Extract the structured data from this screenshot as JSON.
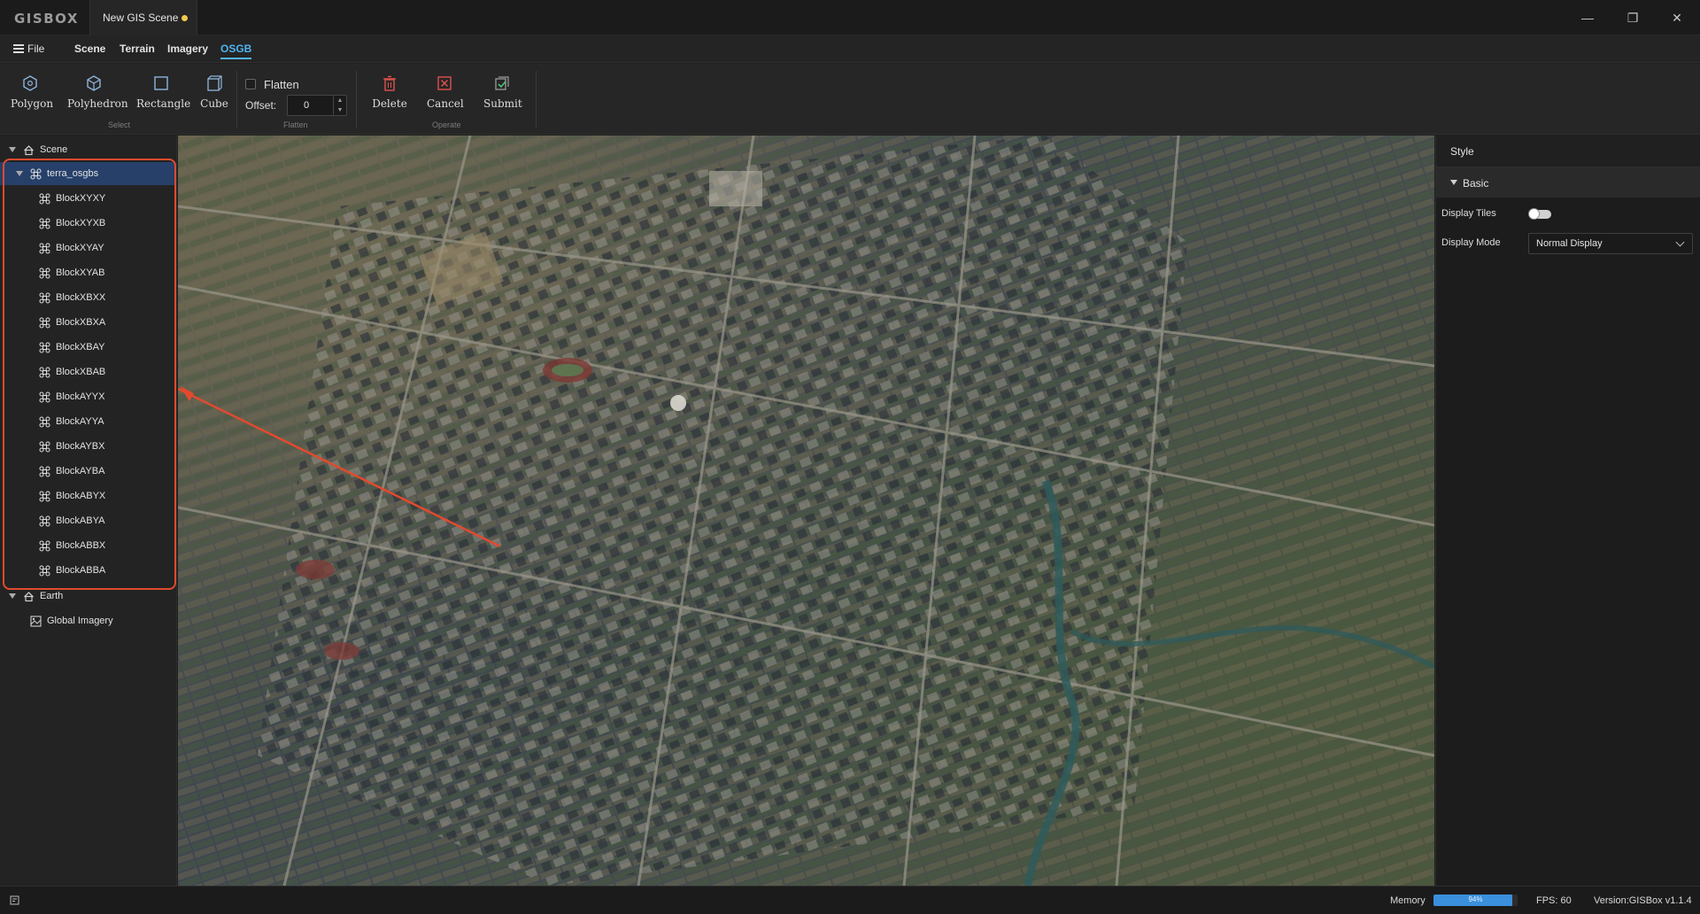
{
  "app": {
    "logo": "GISBOX",
    "doc_tab": "New GIS Scene"
  },
  "window_controls": {
    "minimize": "—",
    "restore": "❐",
    "close": "✕"
  },
  "menu": {
    "file": "File",
    "tabs": [
      "Scene",
      "Terrain",
      "Imagery",
      "OSGB"
    ],
    "active_tab": "OSGB"
  },
  "ribbon": {
    "select_buttons": [
      "Polygon",
      "Polyhedron",
      "Rectangle",
      "Cube"
    ],
    "select_group": "Select",
    "flatten_label": "Flatten",
    "flatten_checked": false,
    "offset_label": "Offset:",
    "offset_value": "0",
    "flatten_group": "Flatten",
    "operate_buttons": [
      "Delete",
      "Cancel",
      "Submit"
    ],
    "operate_group": "Operate"
  },
  "tree": {
    "scene_label": "Scene",
    "selected_node": "terra_osgbs",
    "blocks": [
      "BlockXYXY",
      "BlockXYXB",
      "BlockXYAY",
      "BlockXYAB",
      "BlockXBXX",
      "BlockXBXA",
      "BlockXBAY",
      "BlockXBAB",
      "BlockAYYX",
      "BlockAYYA",
      "BlockAYBX",
      "BlockAYBA",
      "BlockABYX",
      "BlockABYA",
      "BlockABBX",
      "BlockABBA"
    ],
    "earth_label": "Earth",
    "imagery_label": "Global Imagery"
  },
  "right_panel": {
    "tab": "Style",
    "section": "Basic",
    "display_tiles_label": "Display Tiles",
    "display_tiles_on": false,
    "display_mode_label": "Display Mode",
    "display_mode_value": "Normal Display"
  },
  "status": {
    "memory_label": "Memory",
    "memory_percent": 94,
    "memory_text": "94%",
    "fps": "FPS: 60",
    "version": "Version:GISBox v1.1.4"
  },
  "colors": {
    "accent": "#4fb3f0",
    "highlight_box": "#e24a2e",
    "arrow": "#e24a2e",
    "selected_row": "#26406a"
  }
}
